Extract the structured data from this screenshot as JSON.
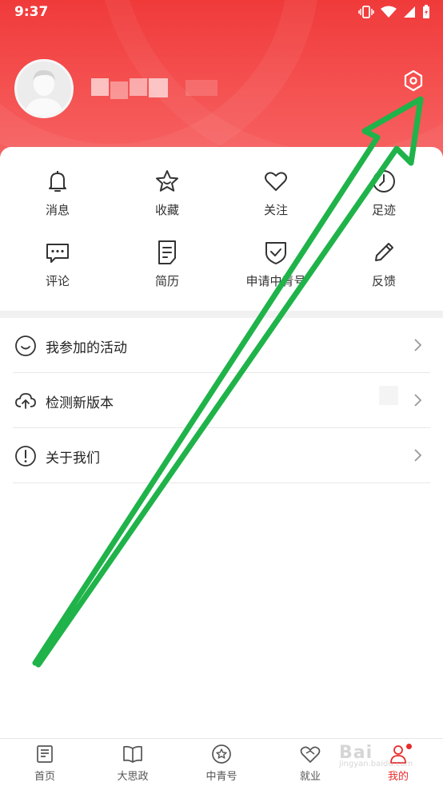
{
  "status_bar": {
    "time": "9:37"
  },
  "profile": {
    "avatar": "avatar-placeholder",
    "username_hidden": true
  },
  "quick_actions": [
    {
      "label": "消息",
      "icon": "bell-icon"
    },
    {
      "label": "收藏",
      "icon": "star-icon"
    },
    {
      "label": "关注",
      "icon": "heart-icon"
    },
    {
      "label": "足迹",
      "icon": "clock-icon"
    },
    {
      "label": "评论",
      "icon": "comment-icon"
    },
    {
      "label": "简历",
      "icon": "document-icon"
    },
    {
      "label": "申请中青号",
      "icon": "shield-check-icon"
    },
    {
      "label": "反馈",
      "icon": "pencil-icon"
    }
  ],
  "menu": [
    {
      "label": "我参加的活动",
      "icon": "smile-icon"
    },
    {
      "label": "检测新版本",
      "icon": "cloud-upload-icon"
    },
    {
      "label": "关于我们",
      "icon": "info-exclamation-icon"
    }
  ],
  "tabbar": [
    {
      "label": "首页",
      "icon": "newspaper-icon"
    },
    {
      "label": "大思政",
      "icon": "book-icon"
    },
    {
      "label": "中青号",
      "icon": "star-circle-icon"
    },
    {
      "label": "就业",
      "icon": "heart-handshake-icon"
    },
    {
      "label": "我的",
      "icon": "user-icon",
      "active": true
    }
  ],
  "watermark": {
    "brand": "Bai",
    "tag": "jingyan.baidu.com"
  },
  "colors": {
    "header_red": "#f03a3a",
    "active_red": "#e82b2b",
    "annotation_green": "#1fb34a"
  }
}
